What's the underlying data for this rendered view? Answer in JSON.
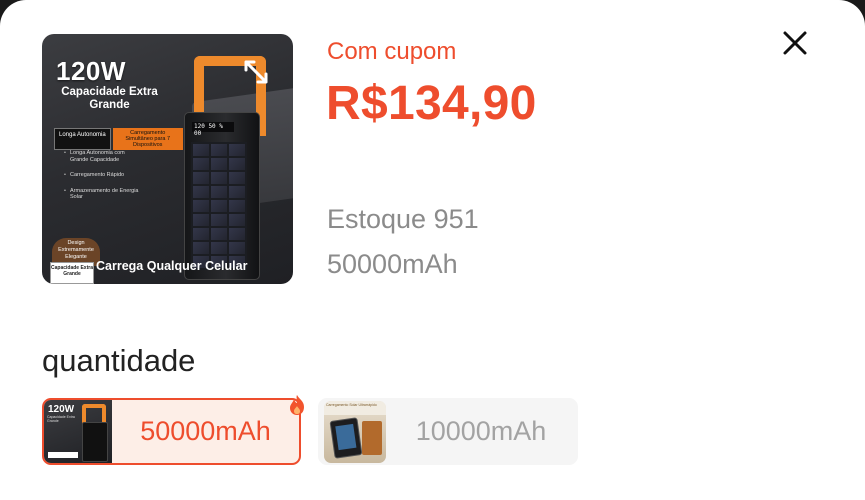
{
  "product": {
    "image": {
      "title": "120W",
      "subtitle": "Capacidade Extra Grande",
      "tag_left": "Longa Autonomia",
      "tag_right": "Carregamento Simultâneo para 7 Dispositivos",
      "bullets": [
        "Longa Autonomia com Grande Capacidade",
        "Carregamento Rápido",
        "Armazenamento de Energia Solar"
      ],
      "display_text": "120 50 % 00",
      "badge_text": "Design Extremamente Elegante",
      "badge2_text": "Capacidade Extra Grande",
      "footer": "Carrega Qualquer Celular"
    }
  },
  "pricing": {
    "coupon_label": "Com cupom",
    "price": "R$134,90"
  },
  "details": {
    "stock": "Estoque 951",
    "selected_variant": "50000mAh"
  },
  "quantity_section": {
    "title": "quantidade"
  },
  "options": [
    {
      "label": "50000mAh",
      "selected": true,
      "thumb_title": "120W",
      "thumb_sub": "Capacidade Extra Grande"
    },
    {
      "label": "10000mAh",
      "selected": false,
      "thumb_top": "Carregamento Solar Ultrarrápido"
    }
  ],
  "colors": {
    "accent": "#ee4d2d",
    "muted_text": "#8b8b8b",
    "selected_bg": "#fdeee7",
    "unselected_bg": "#f5f5f5"
  },
  "icons": {
    "close": "close-icon",
    "hot": "fire-icon"
  }
}
